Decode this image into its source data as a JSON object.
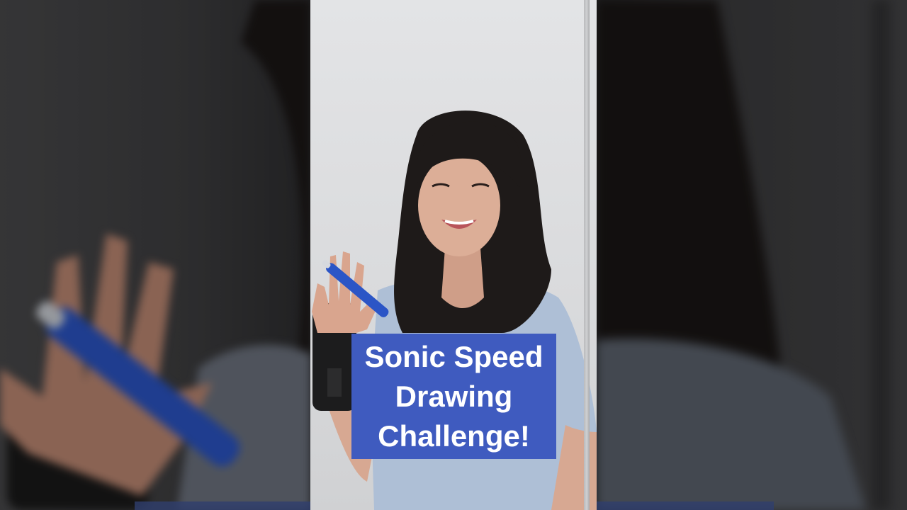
{
  "caption": {
    "line1": "Sonic Speed",
    "line2": "Drawing",
    "line3": "Challenge!"
  },
  "colors": {
    "caption_bg": "#3f5bbf",
    "caption_text": "#ffffff",
    "wall": "#dcdddf",
    "shirt": "#aebfd6",
    "hair": "#1e1a19",
    "marker": "#2b55c6"
  }
}
